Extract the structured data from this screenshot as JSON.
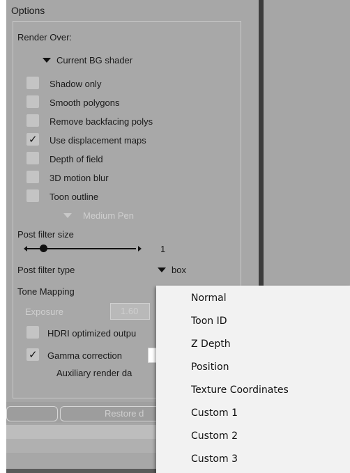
{
  "panel": {
    "title": "Options",
    "render_over_label": "Render Over:",
    "render_over_value": "Current BG shader",
    "checkboxes": [
      {
        "label": "Shadow only",
        "checked": false
      },
      {
        "label": "Smooth polygons",
        "checked": false
      },
      {
        "label": "Remove backfacing polys",
        "checked": false
      },
      {
        "label": "Use displacement maps",
        "checked": true
      },
      {
        "label": "Depth of field",
        "checked": false
      },
      {
        "label": "3D motion blur",
        "checked": false
      },
      {
        "label": "Toon outline",
        "checked": false
      }
    ],
    "toon_pen_value": "Medium Pen",
    "post_filter_size_label": "Post filter size",
    "post_filter_size_value": "1",
    "post_filter_type_label": "Post filter type",
    "post_filter_type_value": "box",
    "tone_mapping_label": "Tone Mapping",
    "exposure_label": "Exposure",
    "exposure_value": "1.60",
    "hdri_label": "HDRI optimized outpu",
    "hdri_checked": false,
    "gamma_label": "Gamma correction",
    "gamma_checked": true,
    "aux_label": "Auxiliary render da",
    "restore_button": "Restore d"
  },
  "menu": {
    "items": [
      "Normal",
      "Toon ID",
      "Z Depth",
      "Position",
      "Texture Coordinates",
      "Custom 1",
      "Custom 2",
      "Custom 3"
    ]
  },
  "colors": {
    "panel_bg": "#a7a7a7",
    "menu_bg": "#f2f2f2",
    "divider": "#3c3c3c"
  }
}
